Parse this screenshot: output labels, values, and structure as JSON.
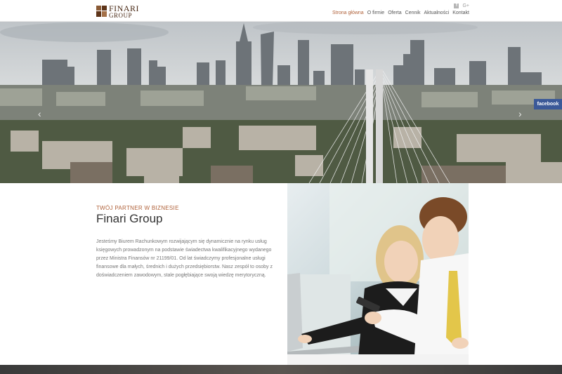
{
  "header": {
    "logo": {
      "name": "FINARI",
      "sub": "GROUP"
    },
    "social": {
      "facebook_icon": "facebook-icon",
      "gplus_label": "G+"
    },
    "nav": [
      {
        "label": "Strona główna",
        "active": true
      },
      {
        "label": "O firmie"
      },
      {
        "label": "Oferta"
      },
      {
        "label": "Cennik"
      },
      {
        "label": "Aktualności"
      },
      {
        "label": "Kontakt"
      }
    ]
  },
  "hero": {
    "facebook_tab": "facebook",
    "slides": 3,
    "active_slide": 0
  },
  "intro": {
    "tagline": "TWÓJ PARTNER W BIZNESIE",
    "title": "Finari Group",
    "description": "Jesteśmy Biurem Rachunkowym rozwijającym się dynamicznie na rynku usług księgowych prowadzonym na podstawie świadectwa kwalifikacyjnego wydanego przez Ministra Finansów nr 21199/01. Od lat świadczymy profesjonalne usługi finansowe dla małych, średnich i dużych przedsiębiorstw. Nasz zespół to osoby z doświadczeniem zawodowym, stale pogłębiające swoją wiedzę merytoryczną."
  },
  "colors": {
    "accent": "#b0623a",
    "logo_brown": "#5e351a",
    "facebook": "#3b5998"
  }
}
